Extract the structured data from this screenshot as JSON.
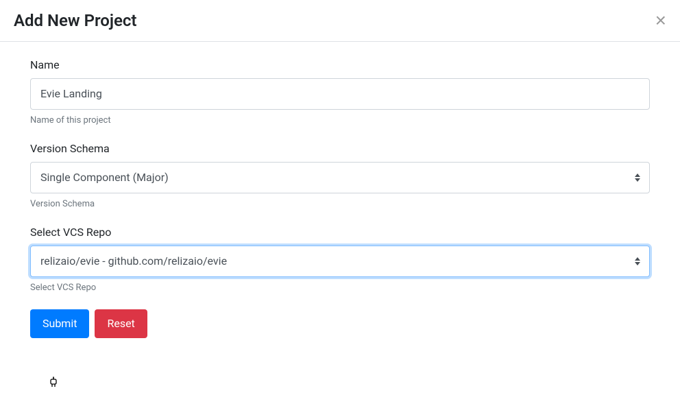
{
  "header": {
    "title": "Add New Project"
  },
  "form": {
    "name": {
      "label": "Name",
      "value": "Evie Landing",
      "help": "Name of this project"
    },
    "versionSchema": {
      "label": "Version Schema",
      "value": "Single Component (Major)",
      "help": "Version Schema"
    },
    "vcsRepo": {
      "label": "Select VCS Repo",
      "value": "relizaio/evie - github.com/relizaio/evie",
      "help": "Select VCS Repo"
    }
  },
  "buttons": {
    "submit": "Submit",
    "reset": "Reset"
  }
}
